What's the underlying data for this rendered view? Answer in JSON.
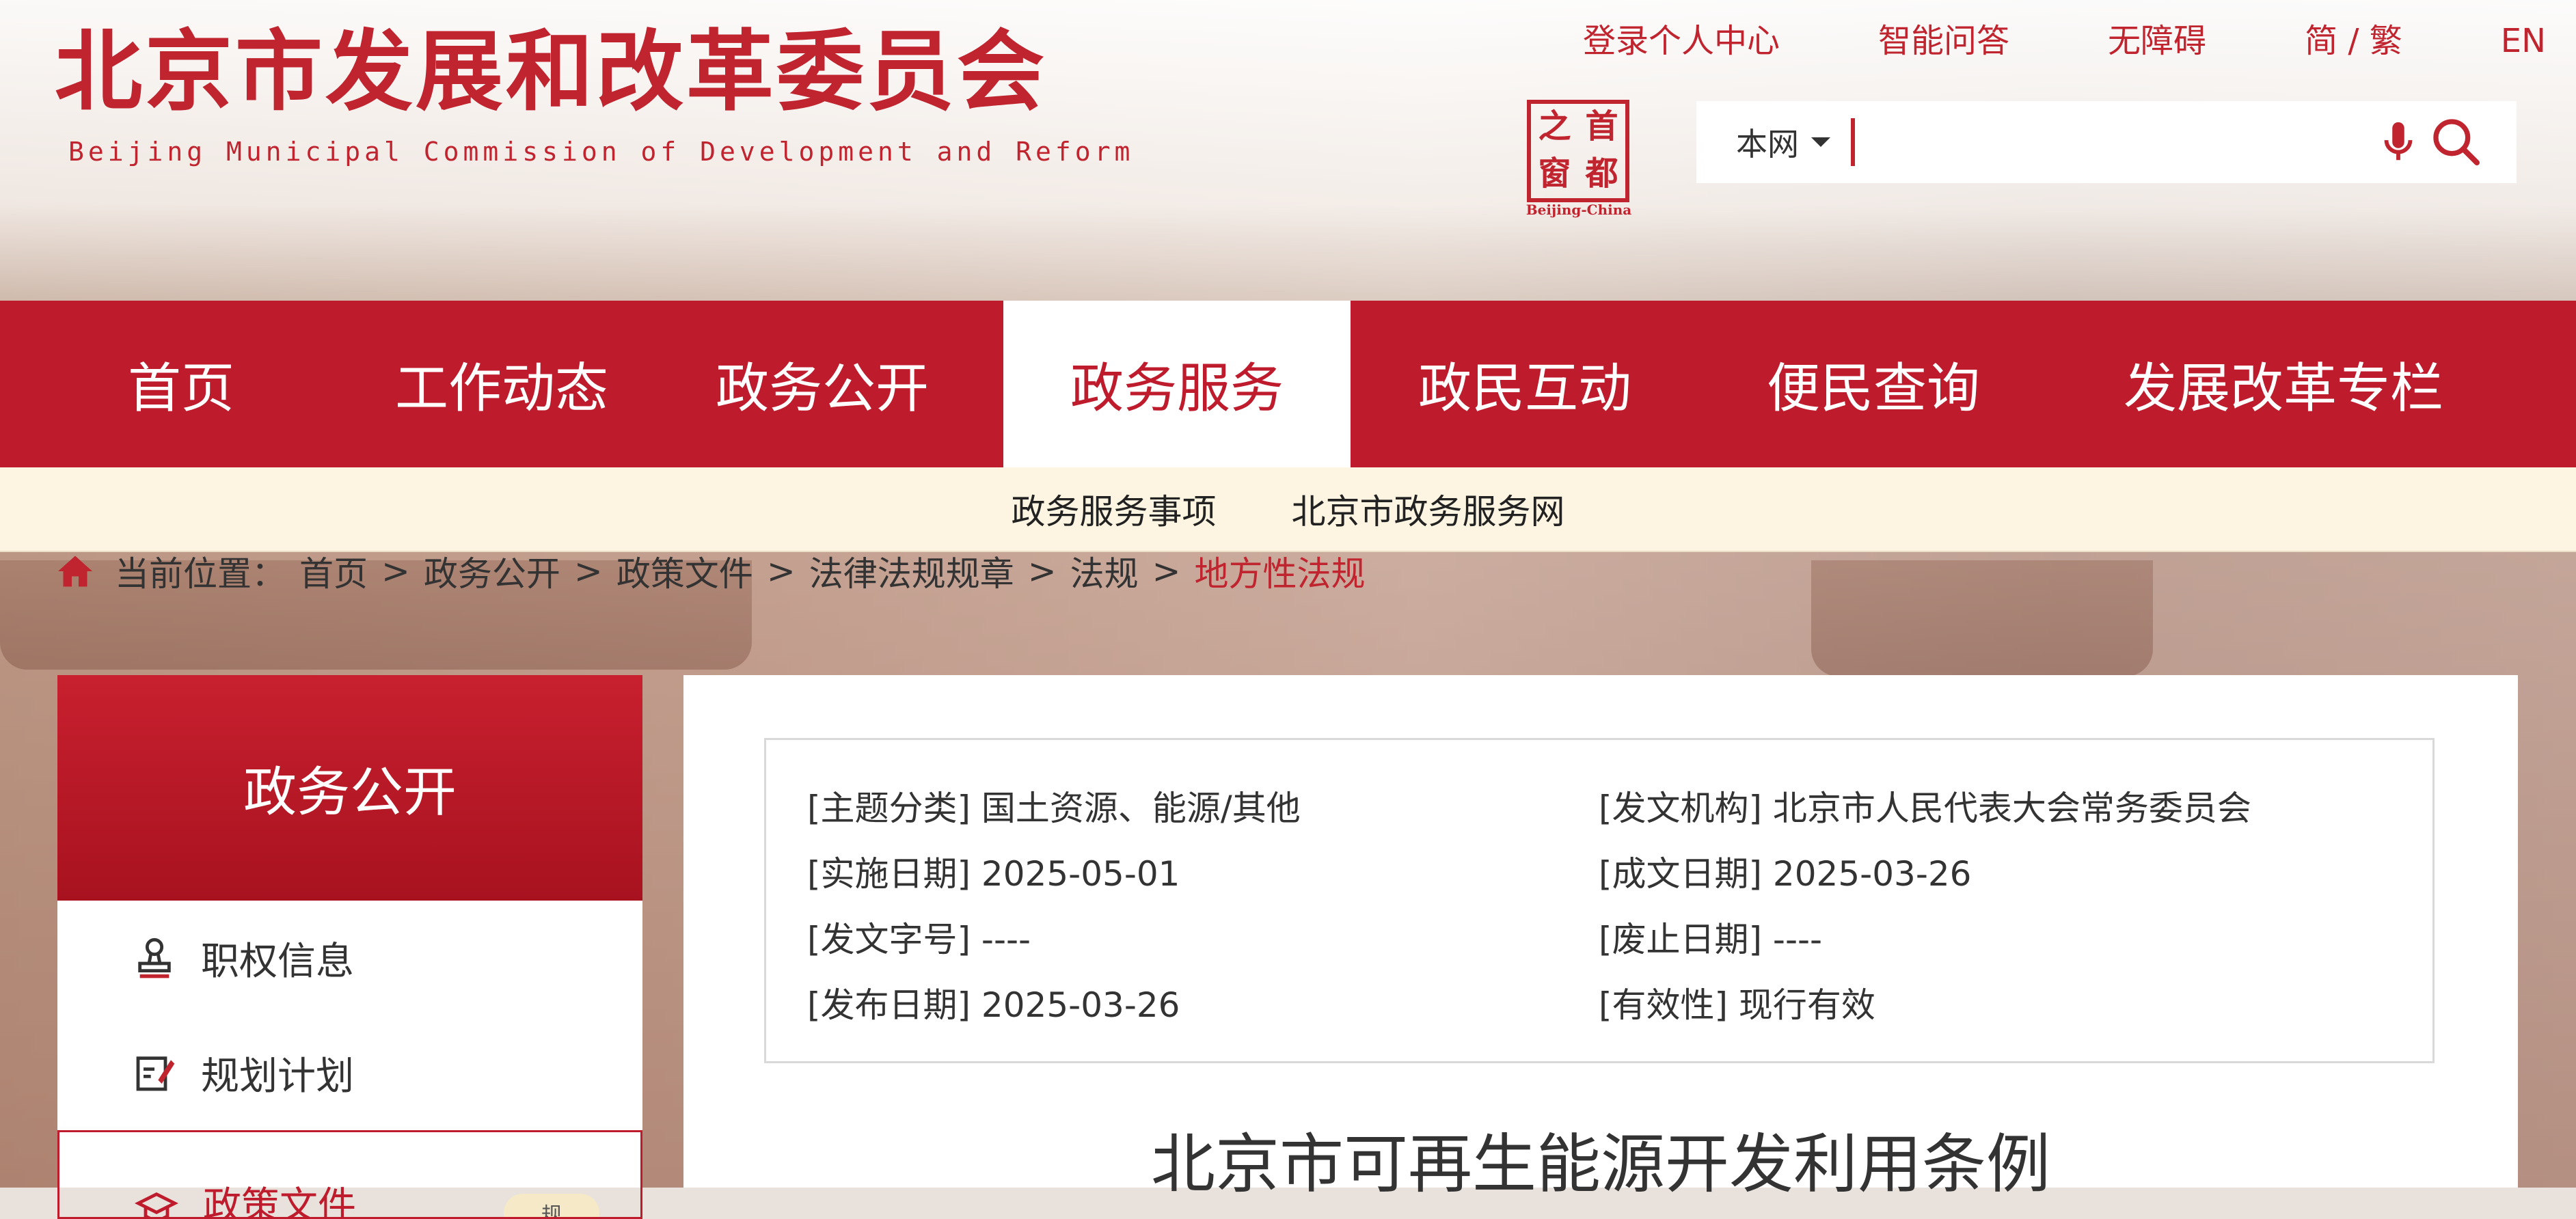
{
  "header": {
    "org_name_cn": "北京市发展和改革委员会",
    "org_name_en": "Beijing Municipal Commission of Development and Reform",
    "top_links": [
      "登录个人中心",
      "智能问答",
      "无障碍",
      "简 / 繁",
      "EN"
    ],
    "seal": {
      "chars": [
        "之",
        "首",
        "窗",
        "都"
      ],
      "caption": "Beijing-China"
    },
    "search": {
      "scope": "本网",
      "placeholder": ""
    }
  },
  "nav": {
    "items": [
      "首页",
      "工作动态",
      "政务公开",
      "政务服务",
      "政民互动",
      "便民查询",
      "发展改革专栏"
    ],
    "active": "政务服务"
  },
  "subnav": {
    "items": [
      "政务服务事项",
      "北京市政务服务网"
    ]
  },
  "breadcrumb": {
    "prefix": "当前位置：",
    "items": [
      "首页",
      "政务公开",
      "政策文件",
      "法律法规规章",
      "法规"
    ],
    "current": "地方性法规"
  },
  "sidebar": {
    "title": "政务公开",
    "items": [
      {
        "label": "职权信息",
        "icon": "stamp-icon"
      },
      {
        "label": "规划计划",
        "icon": "edit-doc-icon"
      },
      {
        "label": "政策文件",
        "icon": "graduation-cap-icon",
        "badge": "规"
      }
    ]
  },
  "document": {
    "meta": [
      {
        "label": "[主题分类]",
        "value": "国土资源、能源/其他"
      },
      {
        "label": "[发文机构]",
        "value": "北京市人民代表大会常务委员会"
      },
      {
        "label": "[实施日期]",
        "value": "2025-05-01"
      },
      {
        "label": "[成文日期]",
        "value": "2025-03-26"
      },
      {
        "label": "[发文字号]",
        "value": "----"
      },
      {
        "label": "[废止日期]",
        "value": "----"
      },
      {
        "label": "[发布日期]",
        "value": "2025-03-26"
      },
      {
        "label": "[有效性]",
        "value": "现行有效"
      }
    ],
    "title": "北京市可再生能源开发利用条例"
  },
  "colors": {
    "brand_red": "#be1b2c",
    "subnav_bg": "#fdf5e2"
  }
}
